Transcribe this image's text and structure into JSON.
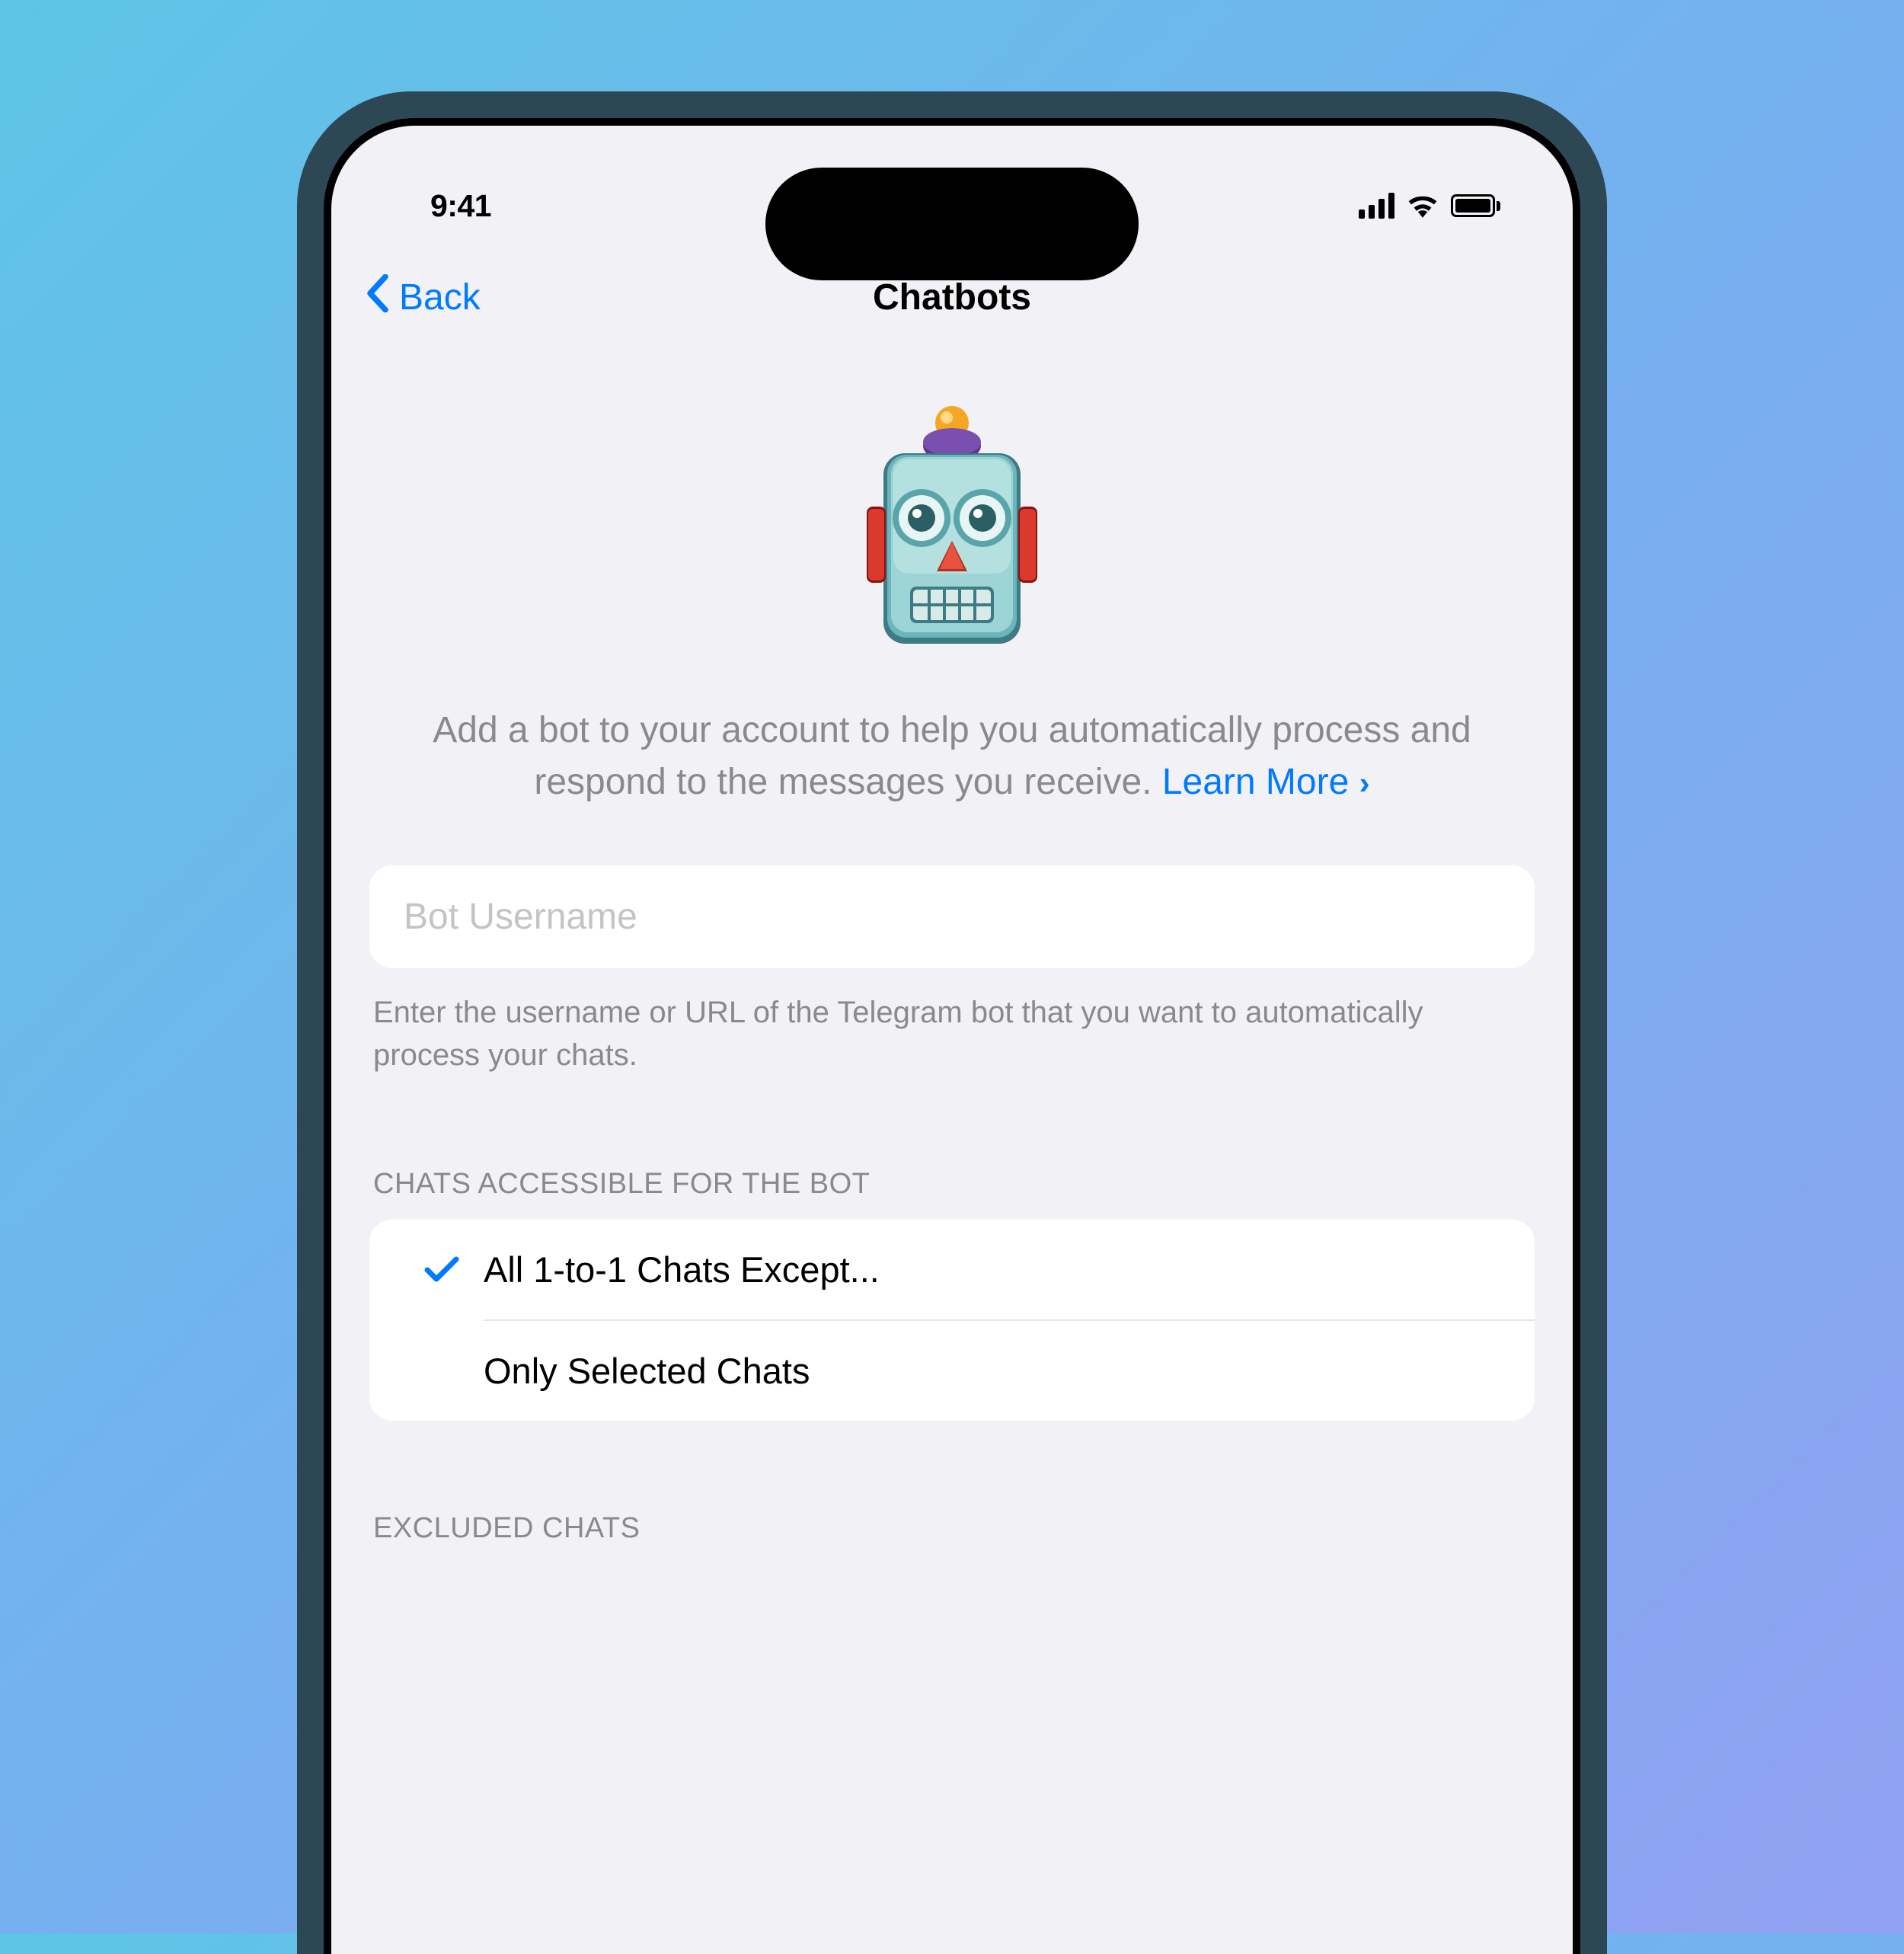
{
  "status": {
    "time": "9:41"
  },
  "nav": {
    "back_label": "Back",
    "title": "Chatbots"
  },
  "header": {
    "description": "Add a bot to your account to help you automatically process and respond to the messages you receive.",
    "learn_more_label": "Learn More"
  },
  "bot_input": {
    "placeholder": "Bot Username",
    "value": "",
    "helper": "Enter the username or URL of the Telegram bot that you want to automatically process your chats."
  },
  "access_section": {
    "header": "CHATS ACCESSIBLE FOR THE BOT",
    "options": [
      {
        "label": "All 1-to-1 Chats Except...",
        "selected": true
      },
      {
        "label": "Only Selected Chats",
        "selected": false
      }
    ]
  },
  "excluded_section": {
    "header": "EXCLUDED CHATS"
  }
}
